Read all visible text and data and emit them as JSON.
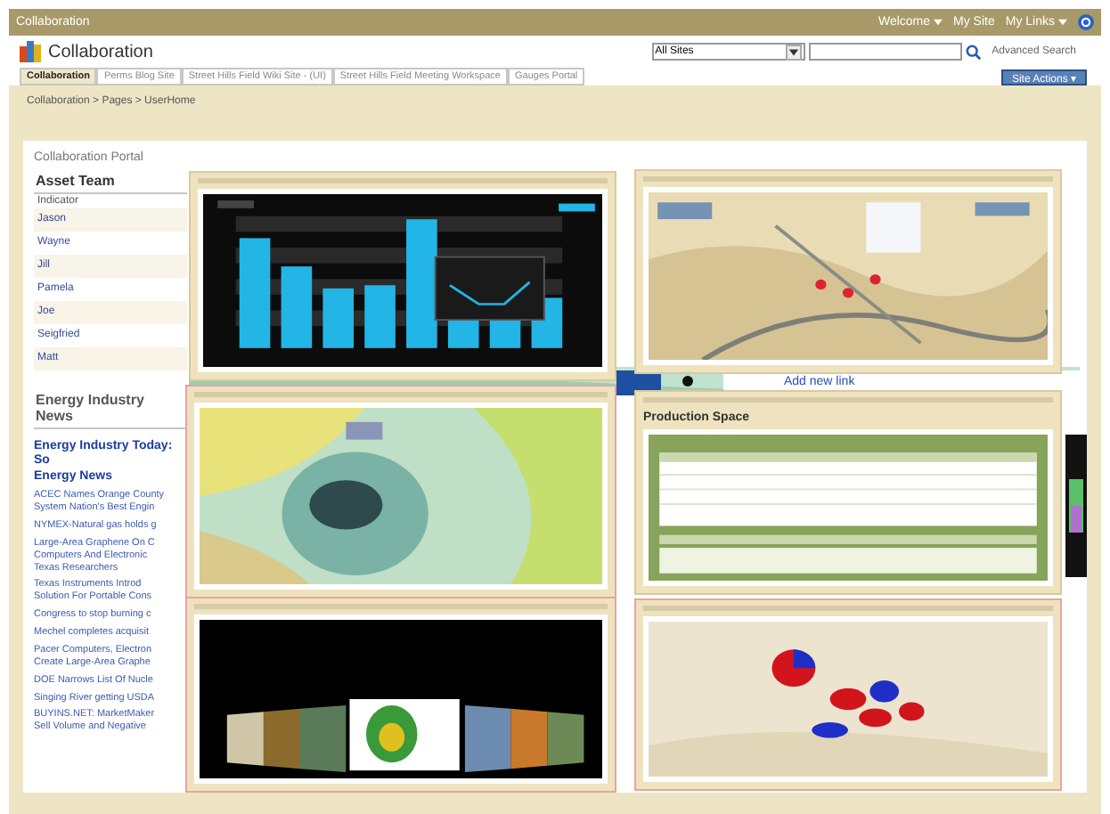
{
  "top_bar": {
    "title": "Collaboration",
    "links": [
      {
        "label": "Welcome",
        "menu": true
      },
      {
        "label": "My Site",
        "menu": false
      },
      {
        "label": "My Links",
        "menu": true
      }
    ]
  },
  "header": {
    "site_title": "Collaboration",
    "search": {
      "scope": "All Sites",
      "advanced": "Advanced Search"
    },
    "site_actions": "Site Actions ▾"
  },
  "tabs": [
    {
      "label": "Collaboration",
      "selected": true
    },
    {
      "label": "Perms Blog Site",
      "selected": false
    },
    {
      "label": "Street Hills Field Wiki Site - (UI)",
      "selected": false
    },
    {
      "label": "Street Hills Field Meeting Workspace",
      "selected": false
    },
    {
      "label": "Gauges Portal",
      "selected": false
    }
  ],
  "breadcrumb": "Collaboration > Pages > UserHome",
  "page_title": "Collaboration Portal",
  "asset_team": {
    "title": "Asset Team",
    "rows": [
      "Indicator",
      "Jason",
      "Wayne",
      "Jill",
      "Pamela",
      "Joe",
      "Seigfried",
      "Matt"
    ]
  },
  "news": {
    "title": "Energy Industry News",
    "headline": [
      "Energy Industry Today: So",
      "Energy News"
    ],
    "items": [
      [
        "ACEC Names Orange County",
        "System Nation's Best Engin"
      ],
      [
        "NYMEX-Natural gas holds g"
      ],
      [
        "Large-Area Graphene On C",
        "Computers And Electronic",
        "Texas Researchers"
      ],
      [
        "Texas Instruments Introd",
        "Solution For Portable Cons"
      ],
      [
        "Congress to stop burning c"
      ],
      [
        "Mechel completes acquisit"
      ],
      [
        "Pacer Computers, Electron",
        "Create Large-Area Graphe"
      ],
      [
        "DOE Narrows List Of Nucle"
      ],
      [
        "Singing River getting USDA"
      ],
      [
        "BUYINS.NET: MarketMaker",
        "Sell Volume and Negative"
      ]
    ]
  },
  "add_link": "Add new link",
  "windows": [
    {
      "kind": "chart"
    },
    {
      "kind": "map"
    },
    {
      "kind": "terrain"
    },
    {
      "kind": "table",
      "title": "Production Space"
    },
    {
      "kind": "coverflow"
    },
    {
      "kind": "pie_map"
    }
  ]
}
